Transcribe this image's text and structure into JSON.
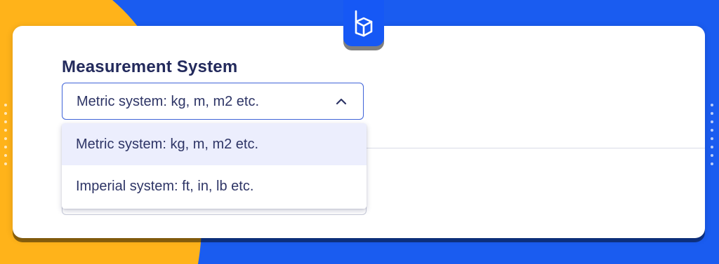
{
  "brand": {
    "logo_name": "building-logo",
    "colors": {
      "background_blue": "#1a5cf0",
      "background_yellow": "#ffb31a",
      "badge_blue": "#1658f5",
      "field_border": "#3f63d8",
      "selected_option_bg": "#eceefd",
      "text_dark": "#232a5c"
    }
  },
  "form": {
    "measurement": {
      "label": "Measurement System",
      "selected_value": "Metric system: kg, m, m2 etc.",
      "expanded_icon": "chevron-up-icon",
      "options": [
        {
          "label": "Metric system: kg, m, m2 etc.",
          "selected": true
        },
        {
          "label": "Imperial system: ft, in, lb etc.",
          "selected": false
        }
      ]
    }
  }
}
